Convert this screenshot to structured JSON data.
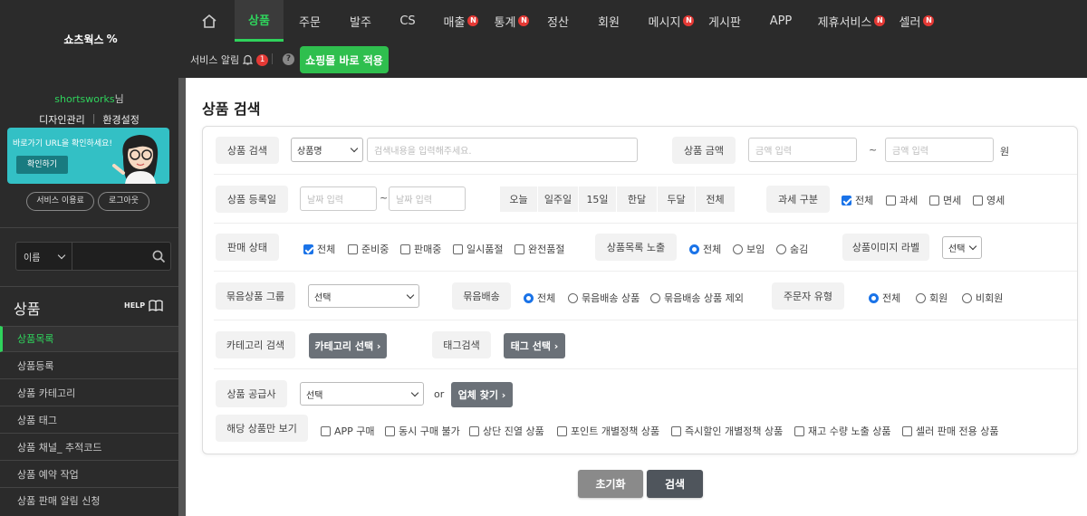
{
  "app": {
    "logo": "쇼츠웍스"
  },
  "nav": [
    {
      "label": "상품",
      "badge": ""
    },
    {
      "label": "주문",
      "badge": ""
    },
    {
      "label": "발주",
      "badge": ""
    },
    {
      "label": "CS",
      "badge": ""
    },
    {
      "label": "매출",
      "badge": "N"
    },
    {
      "label": "통계",
      "badge": "N"
    },
    {
      "label": "정산",
      "badge": ""
    },
    {
      "label": "회원",
      "badge": ""
    },
    {
      "label": "메시지",
      "badge": "N"
    },
    {
      "label": "게시판",
      "badge": ""
    },
    {
      "label": "APP",
      "badge": ""
    },
    {
      "label": "제휴서비스",
      "badge": "N"
    },
    {
      "label": "셀러",
      "badge": "N"
    }
  ],
  "subbar": {
    "alert_label": "서비스 알림",
    "alert_count": "1",
    "help": "?",
    "apply_label": "쇼핑몰 바로 적용"
  },
  "sidebar": {
    "user_name": "shortsworks",
    "user_suffix": "님",
    "design_link": "디자인관리",
    "env_link": "환경설정",
    "banner_text": "바로가기 URL을 확인하세요!",
    "banner_btn": "확인하기",
    "usage_btn": "서비스 이용료",
    "logout_btn": "로그아웃",
    "search_select": "이름",
    "section_title": "상품",
    "help_label": "HELP",
    "menu": [
      "상품목록",
      "상품등록",
      "상품 카테고리",
      "상품 태그",
      "상품 채널_ 추적코드",
      "상품 예약 작업",
      "상품 판매 알림 신청"
    ]
  },
  "page": {
    "title": "상품 검색"
  },
  "form": {
    "product_search": {
      "label": "상품 검색",
      "select": "상품명",
      "placeholder": "검색내용을 입력해주세요."
    },
    "price": {
      "label": "상품 금액",
      "from_placeholder": "금액 입력",
      "tilde": "~",
      "to_placeholder": "금액 입력",
      "unit": "원"
    },
    "reg_date": {
      "label": "상품 등록일",
      "from_placeholder": "날짜 입력",
      "tilde": "~",
      "to_placeholder": "날짜 입력",
      "periods": [
        "오늘",
        "일주일",
        "15일",
        "한달",
        "두달",
        "전체"
      ]
    },
    "tax": {
      "label": "과세 구분",
      "options": [
        {
          "label": "전체",
          "checked": true
        },
        {
          "label": "과세",
          "checked": false
        },
        {
          "label": "면세",
          "checked": false
        },
        {
          "label": "영세",
          "checked": false
        }
      ]
    },
    "sale_status": {
      "label": "판매 상태",
      "options": [
        {
          "label": "전체",
          "checked": true
        },
        {
          "label": "준비중",
          "checked": false
        },
        {
          "label": "판매중",
          "checked": false
        },
        {
          "label": "일시품절",
          "checked": false
        },
        {
          "label": "완전품절",
          "checked": false
        }
      ]
    },
    "list_exposure": {
      "label": "상품목록 노출",
      "options": [
        {
          "label": "전체",
          "checked": true
        },
        {
          "label": "보임",
          "checked": false
        },
        {
          "label": "숨김",
          "checked": false
        }
      ]
    },
    "image_label": {
      "label": "상품이미지 라벨",
      "select": "선택"
    },
    "bundle_group": {
      "label": "묶음상품 그룹",
      "select": "선택"
    },
    "bundle_ship": {
      "label": "묶음배송",
      "options": [
        {
          "label": "전체",
          "checked": true
        },
        {
          "label": "묶음배송 상품",
          "checked": false
        },
        {
          "label": "묶음배송 상품 제외",
          "checked": false
        }
      ]
    },
    "orderer_type": {
      "label": "주문자 유형",
      "options": [
        {
          "label": "전체",
          "checked": true
        },
        {
          "label": "회원",
          "checked": false
        },
        {
          "label": "비회원",
          "checked": false
        }
      ]
    },
    "category": {
      "label": "카테고리 검색",
      "btn": "카테고리 선택 ›"
    },
    "tag": {
      "label": "태그검색",
      "btn": "태그 선택 ›"
    },
    "supplier": {
      "label": "상품 공급사",
      "select": "선택",
      "or": "or",
      "btn": "업체 찾기 ›"
    },
    "filter": {
      "label": "해당 상품만 보기",
      "options": [
        "APP 구매",
        "동시 구매 불가",
        "상단 진열 상품",
        "포인트 개별정책 상품",
        "즉시할인 개별정책 상품",
        "재고 수량 노출 상품",
        "셀러 판매 전용 상품"
      ]
    }
  },
  "actions": {
    "reset": "초기화",
    "search": "검색"
  },
  "colors": {
    "accent_green": "#2fd35c",
    "button_green": "#2fbf4e",
    "topbar": "#2b2b2b",
    "gray_button": "#6b7178",
    "checkbox_blue": "#1a73e8",
    "badge_red": "#e53935"
  }
}
